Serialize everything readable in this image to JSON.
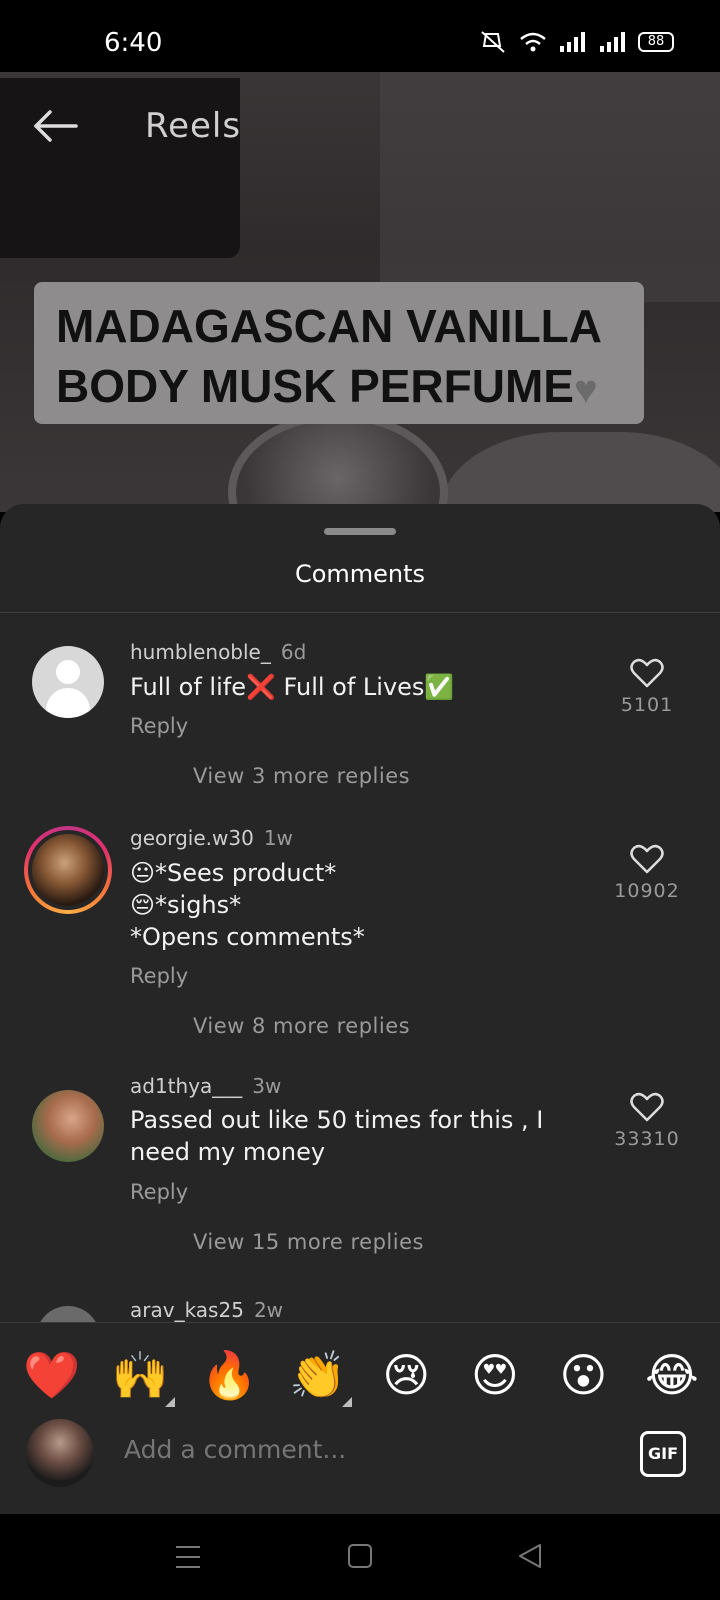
{
  "status_bar": {
    "time": "6:40",
    "battery": "88"
  },
  "header": {
    "title": "Reels"
  },
  "video": {
    "caption_line1": "MADAGASCAN VANILLA",
    "caption_line2": "BODY MUSK PERFUME"
  },
  "sheet": {
    "title": "Comments"
  },
  "comments": [
    {
      "username": "humblenoble_",
      "time": "6d",
      "text": "Full of life❌ Full of Lives✅",
      "reply": "Reply",
      "likes": "5101",
      "view_more": "View 3 more replies"
    },
    {
      "username": "georgie.w30",
      "time": "1w",
      "text": "😐*Sees product*\n😔*sighs*\n *Opens comments*",
      "reply": "Reply",
      "likes": "10902",
      "view_more": "View 8 more replies"
    },
    {
      "username": "ad1thya___",
      "time": "3w",
      "text": "Passed out like 50 times for this , I need my money",
      "reply": "Reply",
      "likes": "33310",
      "view_more": "View 15 more replies"
    },
    {
      "username": "arav_kas25",
      "time": "2w"
    }
  ],
  "reactions": [
    "❤️",
    "🙌",
    "🔥",
    "👏",
    "😢",
    "😍",
    "😮",
    "😂"
  ],
  "composer": {
    "placeholder": "Add a comment...",
    "gif_label": "GIF"
  },
  "icons": {
    "back": "arrow-left-icon",
    "like": "heart-outline-icon",
    "gif": "gif-icon"
  }
}
